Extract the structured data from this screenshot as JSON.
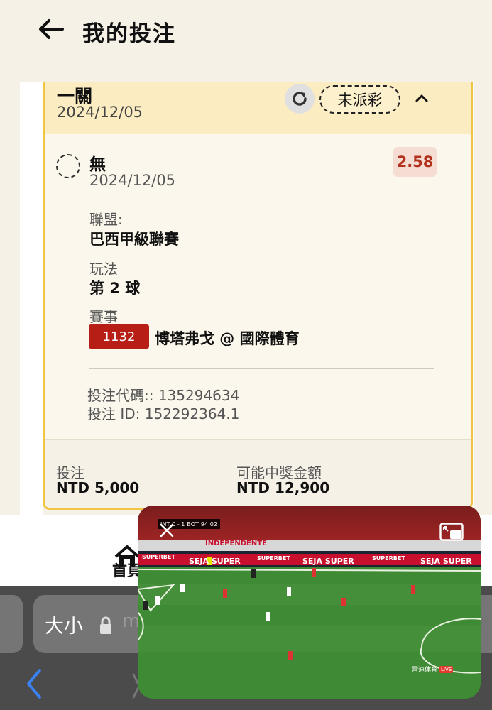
{
  "header": {
    "title": "我的投注"
  },
  "bet": {
    "type_label": "一關",
    "date": "2024/12/05",
    "status": "未派彩",
    "selection": {
      "name": "無",
      "date": "2024/12/05",
      "odds": "2.58",
      "league_label": "聯盟:",
      "league": "巴西甲級聯賽",
      "market_label": "玩法",
      "market": "第 2 球",
      "event_label": "賽事",
      "event_id": "1132",
      "event_name": "博塔弗戈 @ 國際體育"
    },
    "bet_code": "投注代碼:: 135294634",
    "bet_id": "投注 ID: 152292364.1",
    "stake_label": "投注",
    "stake": "NTD 5,000",
    "payout_label": "可能中獎金額",
    "payout": "NTD 12,900"
  },
  "nav": {
    "home": "首頁"
  },
  "browser": {
    "font_size_label": "大小",
    "url_fragment": "m"
  },
  "video": {
    "home_team": "INT",
    "score": "0 - 1",
    "away_team": "BOT",
    "clock": "94:02",
    "ad_1": "SUPERBET",
    "ad_2": "SEJA SUPER",
    "ad_3": "SUPERBET",
    "ad_4": "SEJA SUPER",
    "ad_5": "SUPERBET",
    "ad_6": "SEJA SUPER",
    "banner": "INDEPENDENTE",
    "watermark": "雷速体育",
    "live": "LIVE"
  },
  "colors": {
    "accent": "#f1c542",
    "odds_red": "#b3321e",
    "event_badge": "#b71f16",
    "card_head": "#fcecc1"
  }
}
